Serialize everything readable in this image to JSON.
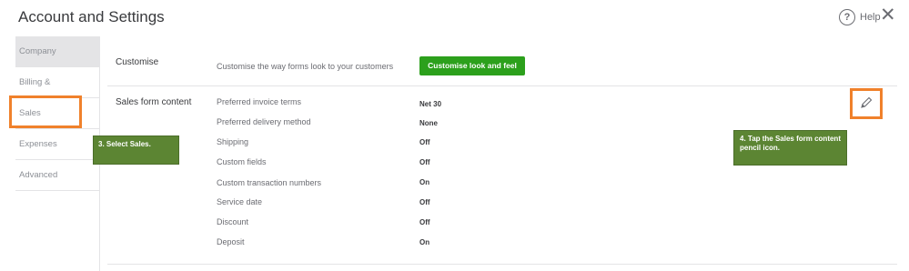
{
  "header": {
    "title": "Account and Settings",
    "help_label": "Help",
    "help_icon_glyph": "?",
    "close_icon_glyph": "✕"
  },
  "sidebar": {
    "items": [
      {
        "label": "Company",
        "selected": true
      },
      {
        "label": "Billing & Subscription"
      },
      {
        "label": "Sales"
      },
      {
        "label": "Expenses"
      },
      {
        "label": "Advanced"
      }
    ]
  },
  "customise": {
    "section_title": "Customise",
    "description": "Customise the way forms look to your customers",
    "button_label": "Customise look and feel"
  },
  "sales_form_content": {
    "section_title": "Sales form content",
    "rows": [
      {
        "label": "Preferred invoice terms",
        "value": "Net 30"
      },
      {
        "label": "Preferred delivery method",
        "value": "None"
      },
      {
        "label": "Shipping",
        "value": "Off"
      },
      {
        "label": "Custom fields",
        "value": "Off"
      },
      {
        "label": "Custom transaction numbers",
        "value": "On"
      },
      {
        "label": "Service date",
        "value": "Off"
      },
      {
        "label": "Discount",
        "value": "Off"
      },
      {
        "label": "Deposit",
        "value": "On"
      }
    ]
  },
  "callouts": {
    "step3_prefix": "3. Select ",
    "step3_bold": "Sales.",
    "step4_prefix": "4.  Tap the ",
    "step4_bold": "Sales form content",
    "step4_suffix": " pencil icon."
  },
  "colors": {
    "accent_green": "#2ca01c",
    "highlight_orange": "#f0812b",
    "callout_green": "#5c8533"
  }
}
